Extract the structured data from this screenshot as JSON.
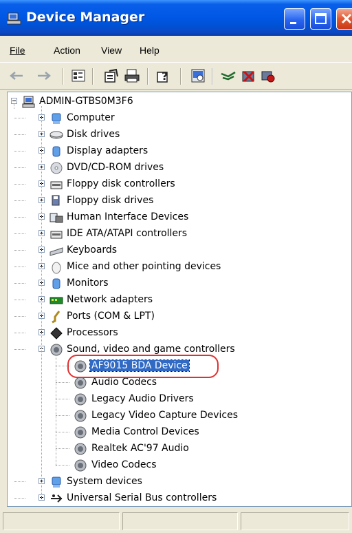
{
  "window": {
    "title": "Device Manager"
  },
  "menu": {
    "file": "File",
    "action": "Action",
    "view": "View",
    "help": "Help"
  },
  "toolbar": {
    "buttons": [
      "back-icon",
      "forward-icon",
      "view-icon",
      "properties-icon",
      "print-icon",
      "help-icon",
      "scan-icon",
      "update-driver-icon",
      "uninstall-icon",
      "disable-icon"
    ]
  },
  "tree": {
    "root": "ADMIN-GTBS0M3F6",
    "categories": [
      {
        "label": "Computer",
        "icon": "computer-icon"
      },
      {
        "label": "Disk drives",
        "icon": "disk-drive-icon"
      },
      {
        "label": "Display adapters",
        "icon": "display-adapter-icon"
      },
      {
        "label": "DVD/CD-ROM drives",
        "icon": "dvd-icon"
      },
      {
        "label": "Floppy disk controllers",
        "icon": "controller-icon"
      },
      {
        "label": "Floppy disk drives",
        "icon": "floppy-icon"
      },
      {
        "label": "Human Interface Devices",
        "icon": "hid-icon"
      },
      {
        "label": "IDE ATA/ATAPI controllers",
        "icon": "controller-icon"
      },
      {
        "label": "Keyboards",
        "icon": "keyboard-icon"
      },
      {
        "label": "Mice and other pointing devices",
        "icon": "mouse-icon"
      },
      {
        "label": "Monitors",
        "icon": "monitor-icon"
      },
      {
        "label": "Network adapters",
        "icon": "network-icon"
      },
      {
        "label": "Ports (COM & LPT)",
        "icon": "port-icon"
      },
      {
        "label": "Processors",
        "icon": "processor-icon"
      },
      {
        "label": "Sound, video and game controllers",
        "icon": "sound-icon"
      }
    ],
    "sound_children": [
      "AF9015 BDA Device",
      "Audio Codecs",
      "Legacy Audio Drivers",
      "Legacy Video Capture Devices",
      "Media Control Devices",
      "Realtek AC'97 Audio",
      "Video Codecs"
    ],
    "after": [
      {
        "label": "System devices",
        "icon": "system-icon"
      },
      {
        "label": "Universal Serial Bus controllers",
        "icon": "usb-icon"
      }
    ],
    "selected": "AF9015 BDA Device"
  },
  "colors": {
    "selection": "#316ac5",
    "highlight_oval": "#e03030",
    "titlebar": "#0058e6"
  }
}
